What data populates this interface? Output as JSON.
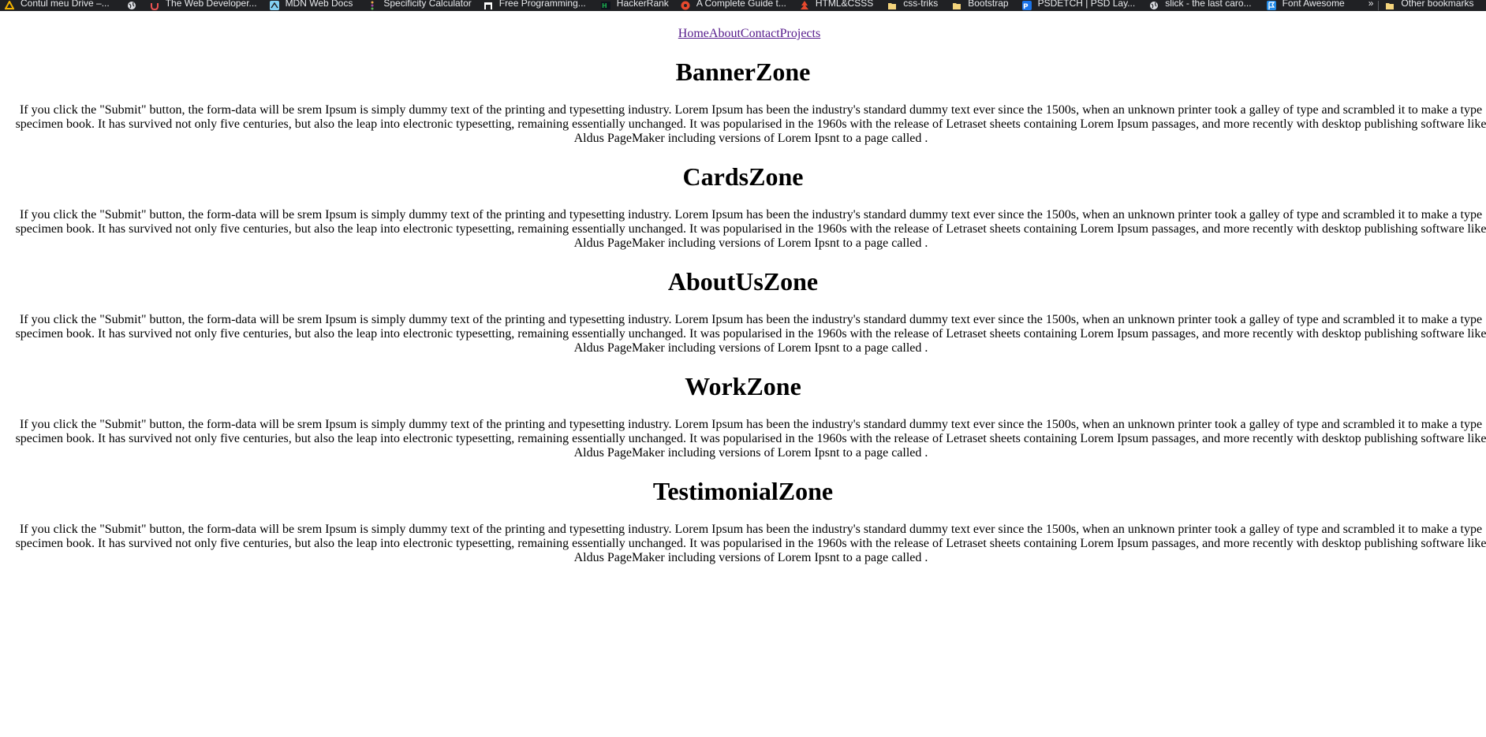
{
  "bookmarks": {
    "items": [
      {
        "label": "Contul meu Drive –...",
        "icon": "google-drive-icon",
        "color": "#f4b400"
      },
      {
        "label": "",
        "icon": "globe-icon",
        "color": "#dadce0"
      },
      {
        "label": "The Web Developer...",
        "icon": "udemy-icon",
        "color": "#ec5252"
      },
      {
        "label": "MDN Web Docs",
        "icon": "mdn-icon",
        "color": "#83d0f2"
      },
      {
        "label": "Specificity Calculator",
        "icon": "specificity-icon",
        "color": "#a349a4"
      },
      {
        "label": "Free Programming...",
        "icon": "freecodecamp-icon",
        "color": "#ffffff"
      },
      {
        "label": "HackerRank",
        "icon": "hackerrank-icon",
        "color": "#1ba94c"
      },
      {
        "label": "A Complete Guide t...",
        "icon": "css-tricks-icon",
        "color": "#e8492d"
      },
      {
        "label": "HTML&CSSS",
        "icon": "tree-icon",
        "color": "#e8492d"
      },
      {
        "label": "css-triks",
        "icon": "folder-icon",
        "color": "#f4d47c"
      },
      {
        "label": "Bootstrap",
        "icon": "folder-icon",
        "color": "#f4d47c"
      },
      {
        "label": "PSDETCH | PSD Lay...",
        "icon": "psdetch-icon",
        "color": "#1a73e8"
      },
      {
        "label": "slick - the last caro...",
        "icon": "globe-icon",
        "color": "#dadce0"
      },
      {
        "label": "Font Awesome",
        "icon": "flag-icon",
        "color": "#228ae6"
      }
    ],
    "overflow": "»",
    "other": {
      "label": "Other bookmarks",
      "icon": "folder-icon",
      "color": "#f4d47c"
    }
  },
  "nav": {
    "home": "Home",
    "about": "About",
    "contact": "Contact",
    "projects": "Projects"
  },
  "body_text": "If you click the \"Submit\" button, the form-data will be srem Ipsum is simply dummy text of the printing and typesetting industry. Lorem Ipsum has been the industry's standard dummy text ever since the 1500s, when an unknown printer took a galley of type and scrambled it to make a type specimen book. It has survived not only five centuries, but also the leap into electronic typesetting, remaining essentially unchanged. It was popularised in the 1960s with the release of Letraset sheets containing Lorem Ipsum passages, and more recently with desktop publishing software like Aldus PageMaker including versions of Lorem Ipsnt to a page called .",
  "sections": [
    {
      "title": "BannerZone"
    },
    {
      "title": "CardsZone"
    },
    {
      "title": "AboutUsZone"
    },
    {
      "title": "WorkZone"
    },
    {
      "title": "TestimonialZone"
    }
  ],
  "colors": {
    "bookmarks_bg": "#202124",
    "bookmarks_text": "#e8eaed",
    "link_visited": "#551a8b",
    "page_bg": "#ffffff"
  }
}
